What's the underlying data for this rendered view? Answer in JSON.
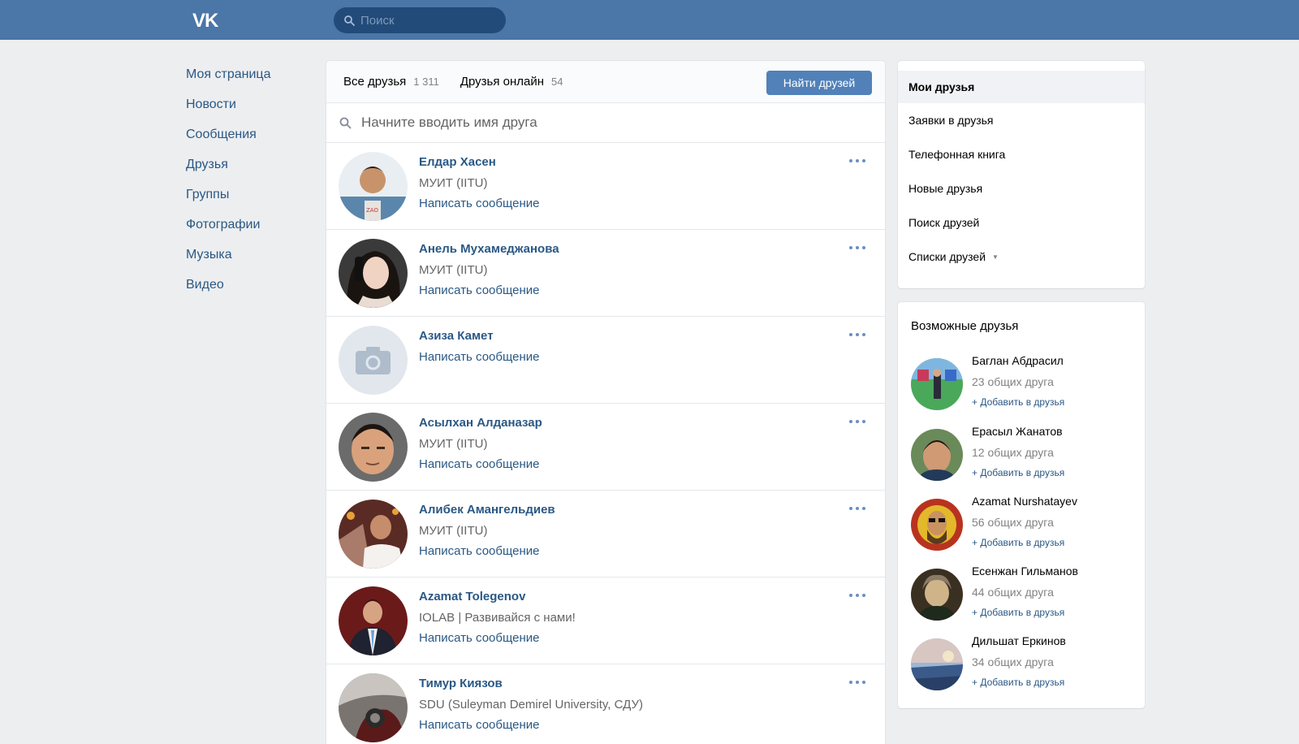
{
  "header": {
    "logo": "VK",
    "search_placeholder": "Поиск"
  },
  "left_nav": [
    {
      "label": "Моя страница"
    },
    {
      "label": "Новости"
    },
    {
      "label": "Сообщения"
    },
    {
      "label": "Друзья"
    },
    {
      "label": "Группы"
    },
    {
      "label": "Фотографии"
    },
    {
      "label": "Музыка"
    },
    {
      "label": "Видео"
    }
  ],
  "main": {
    "tabs": [
      {
        "label": "Все друзья",
        "count": "1 311"
      },
      {
        "label": "Друзья онлайн",
        "count": "54"
      }
    ],
    "find_button": "Найти друзей",
    "search_placeholder": "Начните вводить имя друга",
    "write_message": "Написать сообщение",
    "friends": [
      {
        "name": "Елдар Хасен",
        "sub": "МУИТ (IITU)",
        "avatar": "photo"
      },
      {
        "name": "Анель Мухамеджанова",
        "sub": "МУИТ (IITU)",
        "avatar": "photo"
      },
      {
        "name": "Азиза Камет",
        "sub": "",
        "avatar": "camera-placeholder"
      },
      {
        "name": "Асылхан Алданазар",
        "sub": "МУИТ (IITU)",
        "avatar": "photo"
      },
      {
        "name": "Алибек Амангельдиев",
        "sub": "МУИТ (IITU)",
        "avatar": "photo"
      },
      {
        "name": "Azamat Tolegenov",
        "sub": "IOLAB | Развивайся с нами!",
        "avatar": "photo"
      },
      {
        "name": "Тимур Киязов",
        "sub": "SDU (Suleyman Demirel University, СДУ)",
        "avatar": "photo"
      }
    ]
  },
  "right_menu": {
    "items": [
      {
        "label": "Мои друзья",
        "active": true
      },
      {
        "label": "Заявки в друзья"
      },
      {
        "label": "Телефонная книга"
      },
      {
        "label": "Новые друзья"
      },
      {
        "label": "Поиск друзей"
      },
      {
        "label": "Списки друзей",
        "caret": "▼"
      }
    ]
  },
  "possible_friends": {
    "title": "Возможные друзья",
    "add_label": "+ Добавить в друзья",
    "items": [
      {
        "name": "Баглан Абдрасил",
        "common": "23 общих друга"
      },
      {
        "name": "Ерасыл Жанатов",
        "common": "12 общих друга"
      },
      {
        "name": "Azamat Nurshatayev",
        "common": "56 общих друга"
      },
      {
        "name": "Есенжан Гильманов",
        "common": "44 общих друга"
      },
      {
        "name": "Дильшат Еркинов",
        "common": "34 общих друга"
      }
    ]
  },
  "colors": {
    "header_bg": "#4a76a8",
    "link": "#2a5885",
    "button": "#5181b8",
    "page_bg": "#edeef0"
  }
}
